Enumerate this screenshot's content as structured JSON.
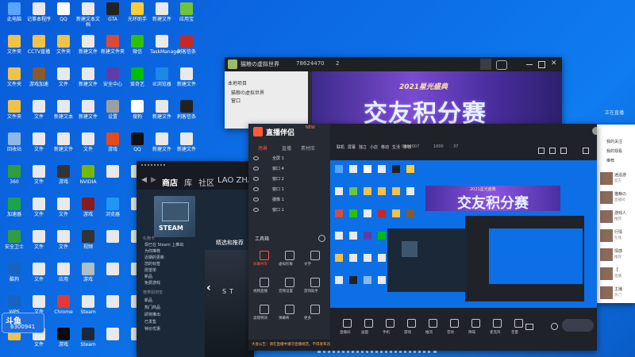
{
  "colors": {
    "desktop": "#0c6fe6",
    "steam": "#1b2838",
    "obs_dark": "#262a33",
    "accent": "#ff5a36"
  },
  "desktop_icons": [
    {
      "label": "此电脑",
      "color": "#58a6ff"
    },
    {
      "label": "记事本程序",
      "color": "#e9e9e9"
    },
    {
      "label": "QQ",
      "color": "#ffffff"
    },
    {
      "label": "新建文本文档",
      "color": "#e9e9e9"
    },
    {
      "label": "GTA",
      "color": "#222222"
    },
    {
      "label": "光环助手",
      "color": "#ffcc33"
    },
    {
      "label": "新建文件",
      "color": "#e9e9e9"
    },
    {
      "label": "应用宝",
      "color": "#6fc43a"
    },
    {
      "label": "文件夹",
      "color": "#f1c24a"
    },
    {
      "label": "CCTV直播",
      "color": "#f1c24a"
    },
    {
      "label": "文件夹",
      "color": "#f1c24a"
    },
    {
      "label": "新建文件",
      "color": "#e9e9e9"
    },
    {
      "label": "新建文件夹",
      "color": "#d94a3a"
    },
    {
      "label": "微信",
      "color": "#2dc100"
    },
    {
      "label": "TaskManager",
      "color": "#e9e9e9"
    },
    {
      "label": "刺客信条",
      "color": "#c62828"
    },
    {
      "label": "文件夹",
      "color": "#f1c24a"
    },
    {
      "label": "游戏加速",
      "color": "#8a5a2a"
    },
    {
      "label": "文件",
      "color": "#e9e9e9"
    },
    {
      "label": "新建文件",
      "color": "#e9e9e9"
    },
    {
      "label": "安全中心",
      "color": "#5f3da6"
    },
    {
      "label": "爱奇艺",
      "color": "#00be06"
    },
    {
      "label": "IE浏览器",
      "color": "#1e88e5"
    },
    {
      "label": "新建文件",
      "color": "#e9e9e9"
    },
    {
      "label": "文件夹",
      "color": "#f1c24a"
    },
    {
      "label": "文件",
      "color": "#e9e9e9"
    },
    {
      "label": "新建文本",
      "color": "#e9e9e9"
    },
    {
      "label": "新建文件",
      "color": "#e9e9e9"
    },
    {
      "label": "设置",
      "color": "#9e9e9e"
    },
    {
      "label": "搜狗",
      "color": "#ffffff"
    },
    {
      "label": "新建文件",
      "color": "#e9e9e9"
    },
    {
      "label": "刺客信条",
      "color": "#222222"
    },
    {
      "label": "回收站",
      "color": "#8fb8e6"
    },
    {
      "label": "文件",
      "color": "#e9e9e9"
    },
    {
      "label": "新建文件",
      "color": "#e9e9e9"
    },
    {
      "label": "文件",
      "color": "#e9e9e9"
    },
    {
      "label": "游戏",
      "color": "#e64a19"
    },
    {
      "label": "QQ",
      "color": "#111111"
    },
    {
      "label": "新建文件",
      "color": "#e9e9e9"
    },
    {
      "label": "新建文件",
      "color": "#e9e9e9"
    },
    {
      "label": "360",
      "color": "#2e9e3e"
    },
    {
      "label": "文件",
      "color": "#e9e9e9"
    },
    {
      "label": "游戏",
      "color": "#333333"
    },
    {
      "label": "NVIDIA",
      "color": "#76b900"
    },
    {
      "label": "",
      "color": "#e9e9e9"
    },
    {
      "label": "",
      "color": "#e9e9e9"
    },
    {
      "label": "",
      "color": "#e9e9e9"
    },
    {
      "label": "",
      "color": "#e9e9e9"
    },
    {
      "label": "加速器",
      "color": "#1fa34a"
    },
    {
      "label": "文件",
      "color": "#e9e9e9"
    },
    {
      "label": "文件",
      "color": "#e9e9e9"
    },
    {
      "label": "游戏",
      "color": "#8b1a1a"
    },
    {
      "label": "浏览器",
      "color": "#2196f3"
    },
    {
      "label": "",
      "color": "#e9e9e9"
    },
    {
      "label": "",
      "color": "#e9e9e9"
    },
    {
      "label": "",
      "color": "#e9e9e9"
    },
    {
      "label": "安全卫士",
      "color": "#2e9e3e"
    },
    {
      "label": "文件",
      "color": "#e9e9e9"
    },
    {
      "label": "文件",
      "color": "#e9e9e9"
    },
    {
      "label": "视频",
      "color": "#333333"
    },
    {
      "label": "",
      "color": "#e9e9e9"
    },
    {
      "label": "",
      "color": "#e9e9e9"
    },
    {
      "label": "",
      "color": "#e9e9e9"
    },
    {
      "label": "",
      "color": "#e9e9e9"
    },
    {
      "label": "酷狗",
      "color": "#1565c0"
    },
    {
      "label": "文件",
      "color": "#e9e9e9"
    },
    {
      "label": "应用",
      "color": "#e9e9e9"
    },
    {
      "label": "游戏",
      "color": "#b0bec5"
    },
    {
      "label": "",
      "color": "#e9e9e9"
    },
    {
      "label": "",
      "color": "#e9e9e9"
    },
    {
      "label": "",
      "color": "#e9e9e9"
    },
    {
      "label": "",
      "color": "#e9e9e9"
    },
    {
      "label": "WPS",
      "color": "#1565c0"
    },
    {
      "label": "文件",
      "color": "#e9e9e9"
    },
    {
      "label": "Chrome",
      "color": "#e53935"
    },
    {
      "label": "Steam",
      "color": "#e9e9e9"
    },
    {
      "label": "",
      "color": "#e9e9e9"
    },
    {
      "label": "",
      "color": "#e9e9e9"
    },
    {
      "label": "",
      "color": "#e9e9e9"
    },
    {
      "label": "",
      "color": "#e9e9e9"
    },
    {
      "label": "",
      "color": "#f1c24a"
    },
    {
      "label": "文件",
      "color": "#e9e9e9"
    },
    {
      "label": "游戏",
      "color": "#0a0a0a"
    },
    {
      "label": "Steam",
      "color": "#1b2838"
    },
    {
      "label": "",
      "color": "#e9e9e9"
    },
    {
      "label": "",
      "color": "#e9e9e9"
    },
    {
      "label": "",
      "color": "#e9e9e9"
    },
    {
      "label": "",
      "color": "#e9e9e9"
    }
  ],
  "bottom_tray": {
    "logo": "斗鱼",
    "room": "6300941"
  },
  "back_window": {
    "title": "猫粮の虚拟世界",
    "room_id": "78624470",
    "count": "2",
    "banner": "交友积分赛",
    "banner_small": "2021星光盛典",
    "tree_header": "本地项目",
    "tree_items": [
      "猫粮の虚拟世界",
      "窗口"
    ]
  },
  "right_panel": {
    "header": "正在直播",
    "items": [
      "我的关注",
      "我的观看",
      "推荐"
    ],
    "streamers": [
      {
        "name": "逍遥游",
        "sub": "官方"
      },
      {
        "name": "猫粮の",
        "sub": "直播间"
      },
      {
        "name": "游戏人",
        "sub": "推荐"
      },
      {
        "name": "行情",
        "sub": "在线"
      },
      {
        "name": "情感",
        "sub": "推荐"
      },
      {
        "name": "【 ",
        "sub": "直播"
      },
      {
        "name": "主播",
        "sub": "热门"
      }
    ]
  },
  "steam": {
    "tabs": [
      "商店",
      "库",
      "社区",
      "LAO ZHAN"
    ],
    "banner": "STEAM",
    "featured": "精选和推荐",
    "left_heading": "礼物卡",
    "left_items": [
      "现已在 Steam 上推出",
      "为你推荐",
      "近期的更新",
      "您的标签",
      "愿望单",
      "新品",
      "免费游戏"
    ],
    "left_heading2": "按类别浏览",
    "left_items2": [
      "新品",
      "热门商品",
      "即将推出",
      "已发售",
      "特价优惠"
    ]
  },
  "obs": {
    "app_name": "直播伴侣",
    "app_tag": "NEW",
    "scene_tabs": [
      "场景",
      "直播",
      "素材库"
    ],
    "scenes": [
      "全屏 1",
      "窗口 4",
      "窗口 2",
      "窗口 1",
      "摄像 1",
      "窗口 1"
    ],
    "toolbox_title": "工具箱",
    "tools": [
      "屏幕共享",
      "虚拟形象",
      "文字",
      "视频直播",
      "音频设置",
      "游戏助手",
      "滤镜特效",
      "弹幕秀",
      "更多"
    ],
    "menu": [
      "联机",
      "屏幕",
      "独立",
      "小店",
      "移动",
      "生活",
      "推荐"
    ],
    "stats": {
      "likes": "1000",
      "online": "0000007",
      "viewers": "37"
    },
    "banner": "交友积分赛",
    "controls": [
      "直播间",
      "画面",
      "手机",
      "游戏",
      "推流",
      "音效",
      "降噪",
      "麦克风",
      "音量"
    ],
    "notice": "大会公告：请在直播中遵守直播规范，不得发布违规内容"
  },
  "inner_obs": {
    "banner": "交友积分赛",
    "small": "2021星光盛典"
  }
}
